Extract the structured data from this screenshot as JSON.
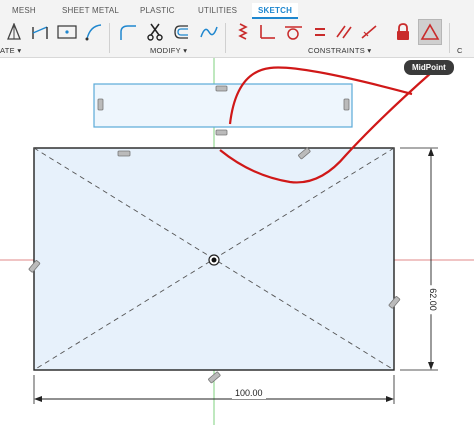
{
  "tabs": [
    "MESH",
    "SHEET METAL",
    "PLASTIC",
    "UTILITIES",
    "SKETCH"
  ],
  "active_tab": "SKETCH",
  "groups": {
    "create_partial": "ATE ▾",
    "modify": "MODIFY ▾",
    "constraints": "CONSTRAINTS ▾",
    "right_partial": "C"
  },
  "tooltip": "MidPoint",
  "dimensions": {
    "width": "100.00",
    "height": "62.00"
  },
  "colors": {
    "accent": "#1f87cf",
    "annotation": "#d01818",
    "constraint_icons": "#c92b2b",
    "sketch_fill": "#e7f1fb",
    "selection": "#5aaad8"
  },
  "icons": {
    "create": [
      "triangle-sketch-icon",
      "line-tool-icon",
      "rectangle-center-icon",
      "arc-tool-icon"
    ],
    "modify": [
      "fillet-icon",
      "trim-scissors-icon",
      "offset-icon",
      "spline-icon"
    ],
    "constraints": [
      "fix-icon",
      "perpendicular-icon",
      "tangent-icon",
      "equal-icon",
      "parallel-icon",
      "collinear-icon",
      "lock-icon",
      "midpoint-constraint-icon"
    ]
  }
}
